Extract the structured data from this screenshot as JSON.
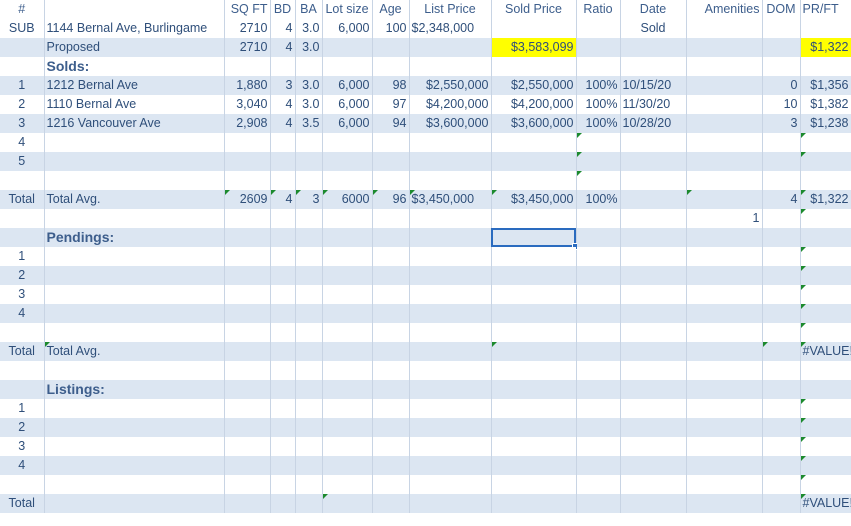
{
  "headers": [
    "#",
    "",
    "SQ FT",
    "BD",
    "BA",
    "Lot size",
    "Age",
    "List Price",
    "Sold Price",
    "Ratio",
    "Date",
    "Amenities",
    "DOM",
    "PR/FT"
  ],
  "subject": {
    "num": "SUB",
    "address": "1144 Bernal Ave, Burlingame",
    "sqft": "2710",
    "bd": "4",
    "ba": "3.0",
    "lot": "6,000",
    "age": "100",
    "list": "$2,348,000",
    "date": "Sold"
  },
  "proposed": {
    "label": "Proposed",
    "sqft": "2710",
    "bd": "4",
    "ba": "3.0",
    "sold": "$3,583,099",
    "prft": "$1,322"
  },
  "solds_label": "Solds:",
  "solds": [
    {
      "num": "1",
      "address": "1212 Bernal Ave",
      "sqft": "1,880",
      "bd": "3",
      "ba": "3.0",
      "lot": "6,000",
      "age": "98",
      "list": "$2,550,000",
      "sold": "$2,550,000",
      "ratio": "100%",
      "date": "10/15/20",
      "dom": "0",
      "prft": "$1,356"
    },
    {
      "num": "2",
      "address": "1110 Bernal Ave",
      "sqft": "3,040",
      "bd": "4",
      "ba": "3.0",
      "lot": "6,000",
      "age": "97",
      "list": "$4,200,000",
      "sold": "$4,200,000",
      "ratio": "100%",
      "date": "11/30/20",
      "dom": "10",
      "prft": "$1,382"
    },
    {
      "num": "3",
      "address": "1216 Vancouver Ave",
      "sqft": "2,908",
      "bd": "4",
      "ba": "3.5",
      "lot": "6,000",
      "age": "94",
      "list": "$3,600,000",
      "sold": "$3,600,000",
      "ratio": "100%",
      "date": "10/28/20",
      "dom": "3",
      "prft": "$1,238"
    },
    {
      "num": "4"
    },
    {
      "num": "5"
    }
  ],
  "solds_total": {
    "num": "Total",
    "label": "Total Avg.",
    "sqft": "2609",
    "bd": "4",
    "ba": "3",
    "lot": "6000",
    "age": "96",
    "list": "$3,450,000",
    "sold": "$3,450,000",
    "ratio": "100%",
    "dom": "4",
    "prft": "$1,322"
  },
  "extra_count": "1",
  "pendings_label": "Pendings:",
  "pendings": [
    "1",
    "2",
    "3",
    "4"
  ],
  "pendings_total": {
    "num": "Total",
    "label": "Total Avg.",
    "prft": "#VALUE!"
  },
  "listings_label": "Listings:",
  "listings": [
    "1",
    "2",
    "3",
    "4"
  ],
  "listings_total": {
    "num": "Total",
    "prft": "#VALUE!"
  }
}
